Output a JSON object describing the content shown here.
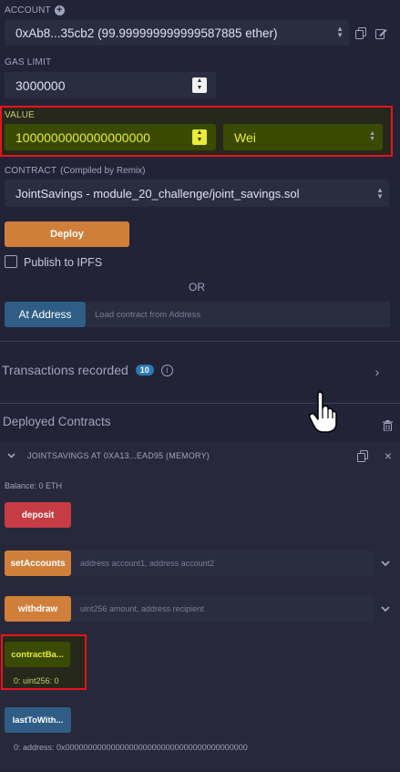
{
  "account": {
    "label": "ACCOUNT",
    "value": "0xAb8...35cb2 (99.999999999999587885 ether)"
  },
  "gas_limit": {
    "label": "GAS LIMIT",
    "value": "3000000"
  },
  "value": {
    "label": "VALUE",
    "amount": "1000000000000000000",
    "unit": "Wei"
  },
  "contract": {
    "label": "CONTRACT",
    "compiled_note": "(Compiled by Remix)",
    "selected": "JointSavings - module_20_challenge/joint_savings.sol"
  },
  "deploy_label": "Deploy",
  "publish_ipfs_label": "Publish to IPFS",
  "or_label": "OR",
  "at_address": {
    "button": "At Address",
    "placeholder": "Load contract from Address"
  },
  "transactions": {
    "label": "Transactions recorded",
    "count": "10"
  },
  "deployed": {
    "title": "Deployed Contracts",
    "instance_title": "JOINTSAVINGS AT 0XA13...EAD95 (MEMORY)",
    "balance": "Balance: 0 ETH",
    "functions": {
      "deposit": "deposit",
      "set_accounts": "setAccounts",
      "set_accounts_placeholder": "address account1, address account2",
      "withdraw": "withdraw",
      "withdraw_placeholder": "uint256 amount, address recipient",
      "contract_balance": "contractBa...",
      "contract_balance_result": "0: uint256: 0",
      "last_to_withdraw": "lastToWith...",
      "last_to_withdraw_result": "0: address: 0x0000000000000000000000000000000000000000"
    }
  },
  "colors": {
    "background": "#222336",
    "deposit_red": "#c63c44",
    "orange": "#d07f3b",
    "view_blue": "#2f5d85",
    "highlight_olive": "#3a4a00",
    "highlight_yellow": "#e8ec3a",
    "annotation_red": "#e8141b"
  }
}
